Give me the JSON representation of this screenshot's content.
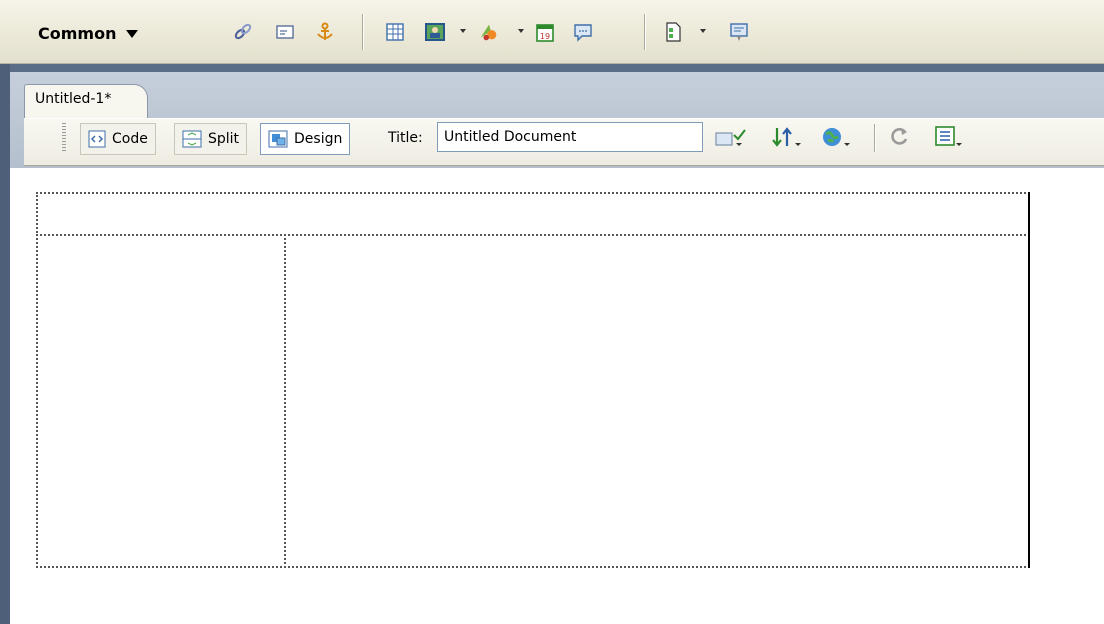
{
  "insert_bar": {
    "category": "Common",
    "icons": [
      {
        "name": "hyperlink-icon"
      },
      {
        "name": "email-link-icon"
      },
      {
        "name": "named-anchor-icon"
      },
      {
        "name": "table-icon"
      },
      {
        "name": "images-icon"
      },
      {
        "name": "media-icon"
      },
      {
        "name": "date-icon"
      },
      {
        "name": "comment-icon"
      },
      {
        "name": "templates-icon"
      },
      {
        "name": "tag-chooser-icon"
      }
    ]
  },
  "document": {
    "tab_label": "Untitled-1*",
    "views": {
      "code": "Code",
      "split": "Split",
      "design": "Design"
    },
    "active_view": "Design",
    "title_label": "Title:",
    "title_value": "Untitled Document"
  },
  "colors": {
    "frame": "#5b6e87",
    "header": "#b4bfcd",
    "toolbar": "#eeece2",
    "active_border": "#7f9db9"
  }
}
